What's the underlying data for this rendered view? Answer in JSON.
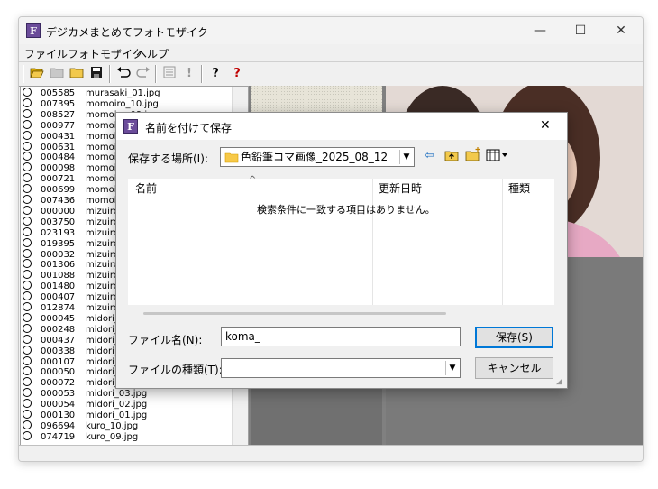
{
  "app": {
    "title": "デジカメまとめてフォトモザイク",
    "icon_letter": "F",
    "caption_buttons": {
      "minimize": "—",
      "maximize": "☐",
      "close": "✕"
    }
  },
  "menu": [
    "ファイル",
    "フォトモザイク",
    "ヘルプ"
  ],
  "toolbar": {
    "icons": [
      "open-folder-icon",
      "folder-icon",
      "open-icon",
      "save-icon",
      "undo-icon",
      "redo-icon",
      "list-icon",
      "exclamation-icon",
      "help-icon",
      "context-help-icon"
    ]
  },
  "file_list": [
    {
      "num": "005585",
      "name": "murasaki_01.jpg"
    },
    {
      "num": "007395",
      "name": "momoiro_10.jpg"
    },
    {
      "num": "008527",
      "name": "momoiro_09.jpg"
    },
    {
      "num": "000977",
      "name": "momoi"
    },
    {
      "num": "000431",
      "name": "momoi"
    },
    {
      "num": "000631",
      "name": "momoi"
    },
    {
      "num": "000484",
      "name": "momoi"
    },
    {
      "num": "000098",
      "name": "momoi"
    },
    {
      "num": "000721",
      "name": "momoi"
    },
    {
      "num": "000699",
      "name": "momoi"
    },
    {
      "num": "007436",
      "name": "momoi"
    },
    {
      "num": "000000",
      "name": "mizuiro"
    },
    {
      "num": "003750",
      "name": "mizuiro"
    },
    {
      "num": "023193",
      "name": "mizuiro"
    },
    {
      "num": "019395",
      "name": "mizuiro"
    },
    {
      "num": "000032",
      "name": "mizuiro"
    },
    {
      "num": "001306",
      "name": "mizuiro"
    },
    {
      "num": "001088",
      "name": "mizuiro"
    },
    {
      "num": "001480",
      "name": "mizuiro"
    },
    {
      "num": "000407",
      "name": "mizuiro"
    },
    {
      "num": "012874",
      "name": "mizuiro"
    },
    {
      "num": "000045",
      "name": "midori_"
    },
    {
      "num": "000248",
      "name": "midori_"
    },
    {
      "num": "000437",
      "name": "midori_"
    },
    {
      "num": "000338",
      "name": "midori_"
    },
    {
      "num": "000107",
      "name": "midori_"
    },
    {
      "num": "000050",
      "name": "midori_"
    },
    {
      "num": "000072",
      "name": "midori_"
    },
    {
      "num": "000053",
      "name": "midori_03.jpg"
    },
    {
      "num": "000054",
      "name": "midori_02.jpg"
    },
    {
      "num": "000130",
      "name": "midori_01.jpg"
    },
    {
      "num": "096694",
      "name": "kuro_10.jpg"
    },
    {
      "num": "074719",
      "name": "kuro_09.jpg"
    }
  ],
  "dialog": {
    "title": "名前を付けて保存",
    "location_label": "保存する場所(I):",
    "location_value": "色鉛筆コマ画像_2025_08_12",
    "columns": [
      "名前",
      "更新日時",
      "種類"
    ],
    "empty_message": "検索条件に一致する項目はありません。",
    "filename_label": "ファイル名(N):",
    "filename_value": "koma_",
    "filetype_label": "ファイルの種類(T):",
    "filetype_value": "",
    "save_button": "保存(S)",
    "cancel_button": "キャンセル",
    "close": "✕"
  }
}
